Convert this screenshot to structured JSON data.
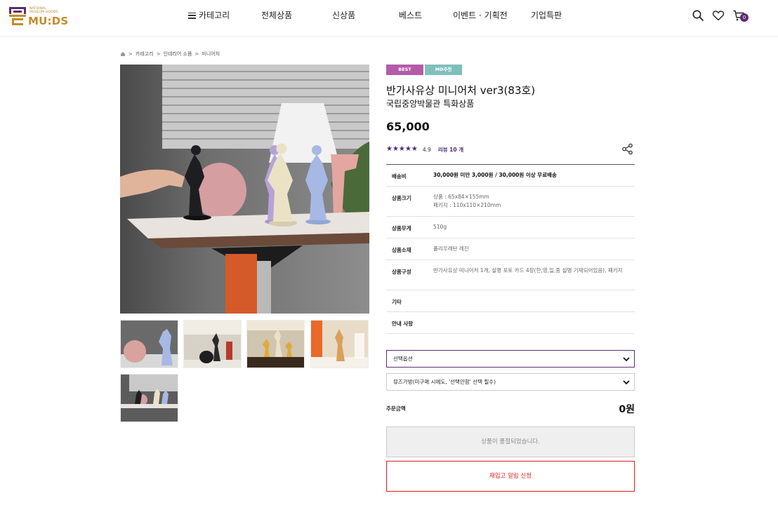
{
  "header": {
    "logo_small_line1": "NATIONAL",
    "logo_small_line2": "MUSEUM GOODS",
    "logo_word": "MU:DS",
    "nav": [
      "카테고리",
      "전체상품",
      "신상품",
      "베스트",
      "이벤트 · 기획전",
      "기업특판"
    ],
    "cart_count": "0"
  },
  "breadcrumb": [
    "카테고리",
    "인테리어 소품",
    "미니어처"
  ],
  "product": {
    "badges": [
      "BEST",
      "MD추천"
    ],
    "title": "반가사유상 미니어처 ver3(83호)",
    "subtitle": "국립중앙박물관 특화상품",
    "price": "65,000",
    "stars": "★★★★★",
    "rating": "4.9",
    "reviews": "리뷰 10 개"
  },
  "info": [
    {
      "key": "배송비",
      "value": "30,000원 미만 3,000원 / 30,000원 이상 무료배송"
    },
    {
      "key": "상품크기",
      "value": "상품 : 65x84×155mm",
      "value2": "패키지 : 110x110×210mm"
    },
    {
      "key": "상품무게",
      "value": "510g"
    },
    {
      "key": "상품소재",
      "value": "폴리우레탄 레진"
    },
    {
      "key": "상품구성",
      "value": "반가사유상 미니어처 1개, 설명 포토 카드 4장(한,영,일,중 설명 기재되어있음), 패키지"
    },
    {
      "key": "기타",
      "value": ""
    },
    {
      "key": "안내 사항",
      "value": ""
    }
  ],
  "options": {
    "select1": "선택옵션",
    "select2": "뮤즈가방(미구매 시에도, '선택안함' 선택 필수)"
  },
  "order": {
    "total_label": "주문금액",
    "total_value": "0원",
    "soldout_label": "상품이 품절되었습니다.",
    "restock_label": "재입고 알림 신청"
  },
  "colors": {
    "brand_gold": "#c38b2a",
    "accent_purple": "#5b2d6e",
    "badge_best": "#b45ba8",
    "badge_md": "#7fbfbd",
    "alert_red": "#d91e1e"
  }
}
